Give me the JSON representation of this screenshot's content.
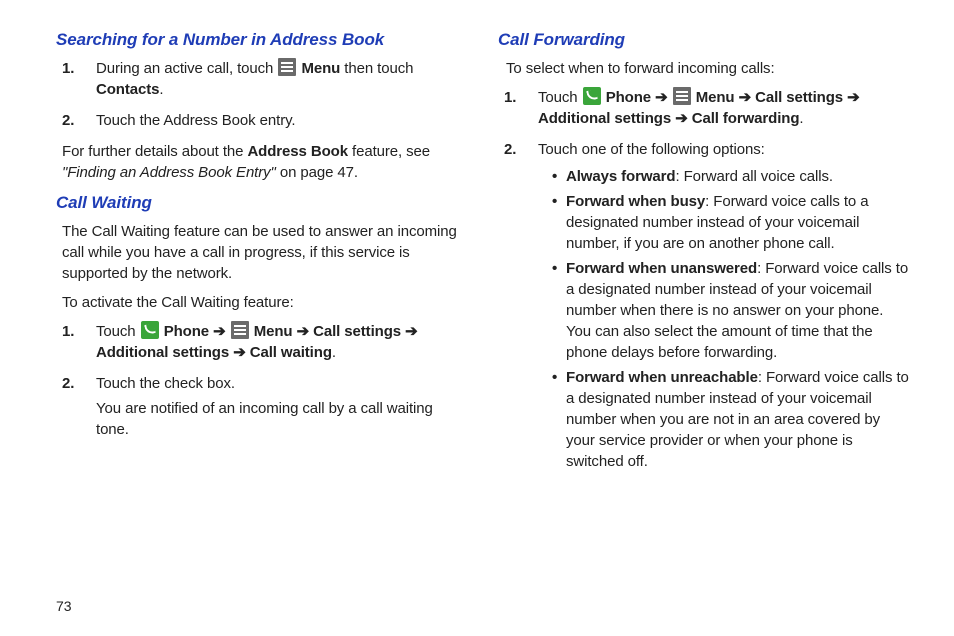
{
  "pageNumber": "73",
  "left": {
    "section1": {
      "title": "Searching for a Number in Address Book",
      "steps": [
        {
          "num": "1.",
          "pre": "During an active call, touch ",
          "menuLabel": "Menu",
          "mid": " then touch ",
          "contactsLabel": "Contacts",
          "end": "."
        },
        {
          "num": "2.",
          "text": "Touch the Address Book entry."
        }
      ],
      "footerPre": "For further details about the ",
      "footerBold": "Address Book",
      "footerMid": " feature, see ",
      "footerItalic": "\"Finding an Address Book Entry\"",
      "footerEnd": " on page 47."
    },
    "section2": {
      "title": "Call Waiting",
      "intro": "The Call Waiting feature can be used to answer an incoming call while you have a call in progress, if this service is supported by the network.",
      "lead": "To activate the Call Waiting feature:",
      "step1": {
        "num": "1.",
        "touch": "Touch ",
        "phoneLabel": "Phone",
        "arrow": " ➔ ",
        "menuLabel": "Menu",
        "callSettings": "Call settings",
        "additional": "Additional settings",
        "callWaiting": "Call waiting",
        "period": "."
      },
      "step2": {
        "num": "2.",
        "line1": "Touch the check box.",
        "line2": "You are notified of an incoming call by a call waiting tone."
      }
    }
  },
  "right": {
    "section": {
      "title": "Call Forwarding",
      "intro": "To select when to forward incoming calls:",
      "step1": {
        "num": "1.",
        "touch": "Touch ",
        "phoneLabel": "Phone",
        "arrow": " ➔ ",
        "menuLabel": "Menu",
        "callSettings": "Call settings",
        "additional": "Additional settings",
        "callForwarding": "Call forwarding",
        "period": "."
      },
      "step2": {
        "num": "2.",
        "lead": "Touch one of the following options:",
        "options": [
          {
            "label": "Always forward",
            "desc": ": Forward all voice calls."
          },
          {
            "label": "Forward when busy",
            "desc": ": Forward voice calls to a designated number instead of your voicemail number, if you are on another phone call."
          },
          {
            "label": "Forward when unanswered",
            "desc": ": Forward voice calls to a designated number instead of your voicemail number when there is no answer on your phone. You can also select the amount of time that the phone delays before forwarding."
          },
          {
            "label": "Forward when unreachable",
            "desc": ": Forward voice calls to a designated number instead of your voicemail number when you are not in an area covered by your service provider or when your phone is switched off."
          }
        ]
      }
    }
  }
}
